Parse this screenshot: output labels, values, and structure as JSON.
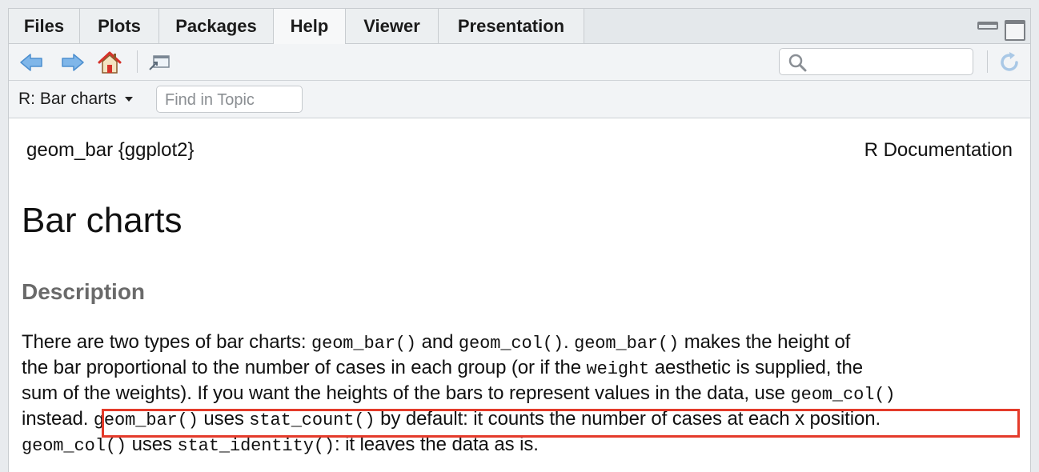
{
  "tabs": [
    {
      "label": "Files",
      "active": false
    },
    {
      "label": "Plots",
      "active": false
    },
    {
      "label": "Packages",
      "active": false
    },
    {
      "label": "Help",
      "active": true
    },
    {
      "label": "Viewer",
      "active": false
    },
    {
      "label": "Presentation",
      "active": false
    }
  ],
  "toolbar": {
    "back_icon": "back-arrow-icon",
    "forward_icon": "forward-arrow-icon",
    "home_icon": "home-icon",
    "popout_icon": "show-in-new-window-icon",
    "search_icon": "search-icon",
    "search_placeholder": "",
    "refresh_icon": "refresh-icon"
  },
  "topicbar": {
    "topic": "R: Bar charts",
    "find_placeholder": "Find in Topic"
  },
  "doc": {
    "package": "geom_bar {ggplot2}",
    "rdoc": "R Documentation",
    "title": "Bar charts",
    "section": "Description",
    "lines": [
      [
        {
          "t": "There are two types of bar charts: "
        },
        {
          "t": "geom_bar()",
          "code": true
        },
        {
          "t": " and "
        },
        {
          "t": "geom_col()",
          "code": true
        },
        {
          "t": ". "
        },
        {
          "t": "geom_bar()",
          "code": true
        },
        {
          "t": " makes the height of"
        }
      ],
      [
        {
          "t": "the bar proportional to the number of cases in each group (or if the "
        },
        {
          "t": "weight",
          "code": true
        },
        {
          "t": " aesthetic is supplied, the"
        }
      ],
      [
        {
          "t": "sum of the weights). If you want the heights of the bars to represent values in the data, use "
        },
        {
          "t": "geom_col()",
          "code": true
        }
      ],
      [
        {
          "t": "instead. "
        },
        {
          "t": "geom_bar()",
          "code": true
        },
        {
          "t": " uses "
        },
        {
          "t": "stat_count()",
          "code": true
        },
        {
          "t": " by default: it counts the number of cases at each x position."
        }
      ],
      [
        {
          "t": "geom_col()",
          "code": true
        },
        {
          "t": " uses "
        },
        {
          "t": "stat_identity()",
          "code": true
        },
        {
          "t": ": it leaves the data as is."
        }
      ]
    ]
  },
  "colors": {
    "highlight": "#e43b2b",
    "accent_blue": "#6aa9e4"
  }
}
